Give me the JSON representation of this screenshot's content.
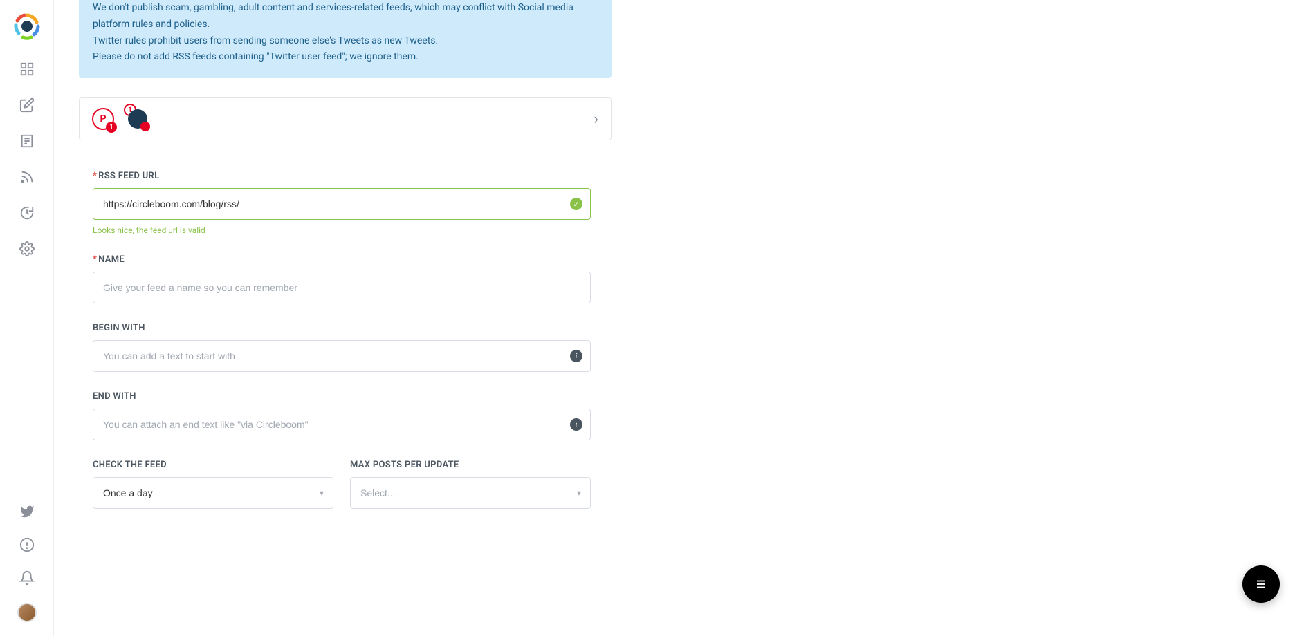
{
  "banner": {
    "line1": "We don't publish scam, gambling, adult content and services-related feeds, which may conflict with Social media platform rules and policies.",
    "line2": "Twitter rules prohibit users from sending someone else's Tweets as new Tweets.",
    "line3": "Please do not add RSS feeds containing \"Twitter user feed\"; we ignore them."
  },
  "accounts": {
    "badge1": "1",
    "badge2": "1"
  },
  "form": {
    "rss": {
      "label": "RSS FEED URL",
      "value": "https://circleboom.com/blog/rss/",
      "valid_msg": "Looks nice, the feed url is valid"
    },
    "name": {
      "label": "NAME",
      "placeholder": "Give your feed a name so you can remember"
    },
    "begin": {
      "label": "BEGIN WITH",
      "placeholder": "You can add a text to start with"
    },
    "end": {
      "label": "END WITH",
      "placeholder": "You can attach an end text like \"via Circleboom\""
    },
    "check": {
      "label": "CHECK THE FEED",
      "value": "Once a day"
    },
    "maxposts": {
      "label": "MAX POSTS PER UPDATE",
      "placeholder": "Select..."
    }
  }
}
